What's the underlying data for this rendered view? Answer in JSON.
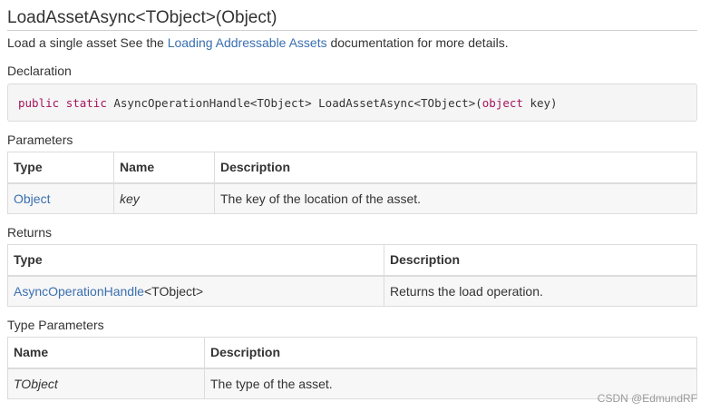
{
  "title": "LoadAssetAsync<TObject>(Object)",
  "description": {
    "before": "Load a single asset See the ",
    "link": "Loading Addressable Assets",
    "after": " documentation for more details."
  },
  "declaration": {
    "heading": "Declaration",
    "kw_public": "public",
    "kw_static": "static",
    "sig_mid": " AsyncOperationHandle<TObject> LoadAssetAsync<TObject>(",
    "kw_object": "object",
    "sig_end": " key)"
  },
  "parameters": {
    "heading": "Parameters",
    "columns": [
      "Type",
      "Name",
      "Description"
    ],
    "rows": [
      {
        "type": "Object",
        "name": "key",
        "description": "The key of the location of the asset."
      }
    ]
  },
  "returns": {
    "heading": "Returns",
    "columns": [
      "Type",
      "Description"
    ],
    "rows": [
      {
        "type_link": "AsyncOperationHandle",
        "type_suffix": "<TObject>",
        "description": "Returns the load operation."
      }
    ]
  },
  "type_parameters": {
    "heading": "Type Parameters",
    "columns": [
      "Name",
      "Description"
    ],
    "rows": [
      {
        "name": "TObject",
        "description": "The type of the asset."
      }
    ]
  },
  "watermark": "CSDN @EdmundRF",
  "colors": {
    "link": "#3a6fb0",
    "keyword": "#a5145d",
    "cell_bg": "#f7f7f7",
    "code_bg": "#f5f5f5"
  }
}
